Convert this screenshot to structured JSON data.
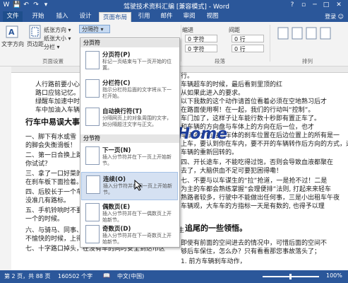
{
  "titlebar": {
    "title": "驾驶技术资料汇编 [兼容模式] - Word",
    "qat": [
      "W",
      "💾",
      "↶",
      "↷",
      "▾"
    ],
    "window_buttons": [
      "?",
      "▫",
      "─",
      "□",
      "✕"
    ]
  },
  "tabs": [
    "文件",
    "开始",
    "插入",
    "设计",
    "页面布局",
    "引用",
    "邮件",
    "审阅",
    "视图"
  ],
  "active_tab": "页面布局",
  "user": "登录 ☺",
  "ribbon": {
    "text_direction": "文字方向",
    "margins": "页边距",
    "orientation": "纸张方向 ▾",
    "size": "纸张大小 ▾",
    "columns": "分栏 ▾",
    "breaks": "分隔符 ▾",
    "indent": "缩进",
    "spacing": "间距",
    "indent_left": "0 字符",
    "indent_right": "0 字符",
    "spacing_before": "0 行",
    "spacing_after": "0 行",
    "arrange": "排列",
    "page_setup_label": "页面设置",
    "paragraph_label": "段落",
    "arrange_label": "排列"
  },
  "menu": {
    "section1": "分页符",
    "section2": "分节符",
    "items": [
      {
        "title": "分页符(P)",
        "desc": "标记一页结束与下一页开始的位置。"
      },
      {
        "title": "分栏符(C)",
        "desc": "指示分栏符后面的文字将从下一栏开始。"
      },
      {
        "title": "自动换行符(T)",
        "desc": "分隔网页上的对象周围的文字，如分隔题注文字与正文。"
      },
      {
        "title": "下一页(N)",
        "desc": "插入分节符并在下一页上开始新节。"
      },
      {
        "title": "连续(O)",
        "desc": "插入分节符并在同一页上开始新节。"
      },
      {
        "title": "偶数页(E)",
        "desc": "插入分节符并在下一偶数页上开始新节。"
      },
      {
        "title": "奇数页(D)",
        "desc": "插入分节符并在下一奇数页上开始新节。"
      }
    ]
  },
  "doc": {
    "left_lines": [
      "人行路前要小心，",
      "路口应铭记忆。",
      "绿醒车加速中时",
      "车中加油入车辆。",
      "行车中易误大事的",
      "一、脚下有水或雪",
      "的脚会失衡滑板！",
      "二、第一日合换上路，",
      "你试试？",
      "三、拿了一口好菜的，",
      "在刹车板下面捡着。",
      "四、后胶长于一个车，",
      "没准几有路标。",
      "五、手机铃响时不要",
      "一个的时候。",
      "六、与骑马、同事、老公、老婆、情人、朋友闲聊或发生",
      "不愉快的时候，上得车来可要小心。",
      "七、十字路口掉头，在没有车的同时安全到达市区"
    ],
    "right_lines": [
      "行。",
      "车辆超车的时候，最后看到里顶的红",
      "从如果此进入的要求。",
      "以下我数的这个动作请首位看着必须在空地熟习后才",
      "在路面使用啊！在一起，我们的行动叫“控制”。",
      "车门加了，这样子让车能行数十秒即有置正车了。",
      "和车辆的方向盘与车体上的方向在后一位，也才",
      "车辆的方向盘与车体的刹车位置在后边位置上的所有是一",
      "上车，要认到你在车内，要不开的车辆转作后方向的方式，遇紧急",
      "车辆的重新回转的。",
      "四、开长途车，不能吃得过饱，否则会导致血液都聚在",
      "去了，大脑供血不足可要犯困得嘞！",
      "七、不要与以车谋生的“拉”抢道，一是抢不过！二是",
      "为主的车都会熟练掌握“会理便排”法则, 打起来来轻车",
      "熟路者较多，行驶中不能做出任何事，三是小出租车午夜",
      "车辆观，大车车的方指标一天是有数的, 也得予以理",
      "",
      "追尾的一些领悟。",
      "即使有前面的空间进去的情况中，可惜后面的空间不",
      "够后车保住，怎么办？只有看看那您事故落头了；",
      "1. 前方车辆刹车动作，"
    ],
    "heading_left": "行车中易误大事的",
    "heading_right": "追尾的一些领悟。"
  },
  "watermark": "WordHome",
  "status": {
    "page": "第 2 页，共 88 页",
    "words": "160502 个字",
    "proof": "📖",
    "lang": "中文(中国)",
    "zoom": "100%"
  }
}
